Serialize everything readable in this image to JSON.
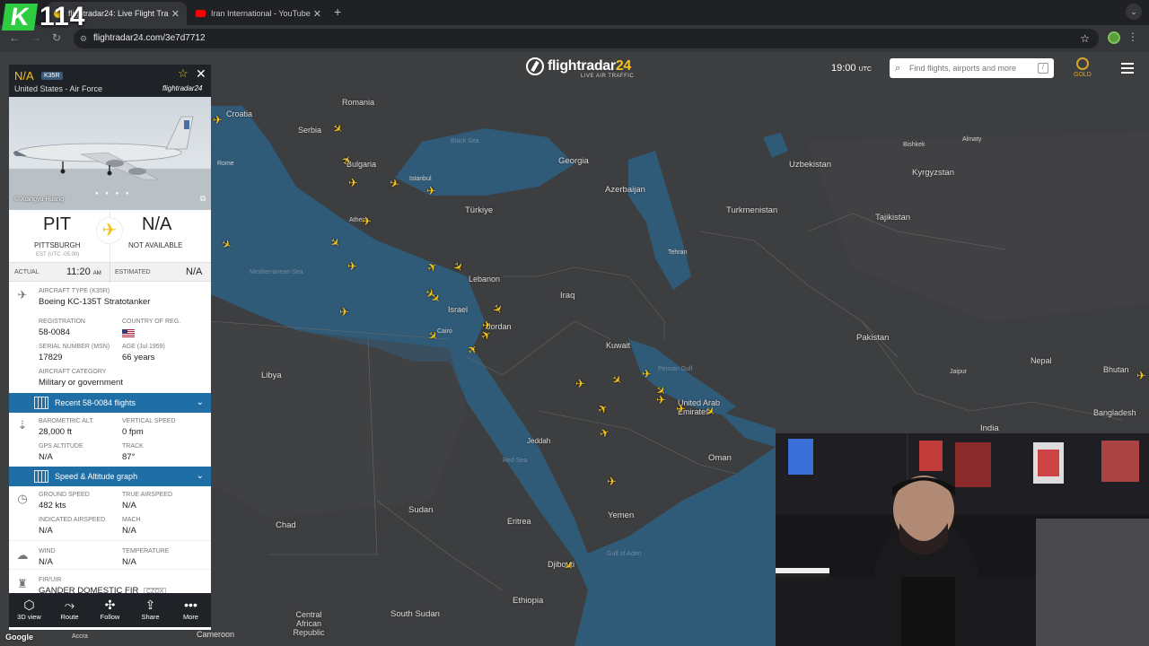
{
  "overlay": {
    "badge_letter": "K",
    "badge_number": "114"
  },
  "browser": {
    "tabs": [
      {
        "title": "flightradar24: Live Flight Tra"
      },
      {
        "title": "Iran International - YouTube"
      }
    ],
    "url": "flightradar24.com/3e7d7712"
  },
  "header": {
    "logo": "flightradar24",
    "logo_accent": "24",
    "tagline": "LIVE AIR TRAFFIC",
    "clock": "19:00",
    "clock_zone": "UTC",
    "search_placeholder": "Find flights, airports and more",
    "search_shortcut": "/",
    "gold_label": "GOLD"
  },
  "flight": {
    "callsign": "N/A",
    "type_code": "K35R",
    "operator": "United States - Air Force",
    "brand": "flightradar24",
    "photo_credit": "© Xiangyu Huang",
    "origin": {
      "code": "PIT",
      "city": "PITTSBURGH",
      "tz": "EST (UTC -05:00)"
    },
    "destination": {
      "code": "N/A",
      "city": "NOT AVAILABLE"
    },
    "times": {
      "actual_label": "ACTUAL",
      "actual": "11:20",
      "actual_suffix": "AM",
      "estimated_label": "ESTIMATED",
      "estimated": "N/A"
    },
    "aircraft": {
      "type_label": "AIRCRAFT TYPE (K35R)",
      "type": "Boeing KC-135T Stratotanker",
      "registration_label": "REGISTRATION",
      "registration": "58-0084",
      "country_label": "COUNTRY OF REG.",
      "serial_label": "SERIAL NUMBER (MSN)",
      "serial": "17829",
      "age_label": "AGE (Jul 1959)",
      "age": "66 years",
      "category_label": "AIRCRAFT CATEGORY",
      "category": "Military or government"
    },
    "recent_flights_bar": "Recent 58-0084 flights",
    "altitude": {
      "baro_label": "BAROMETRIC ALT.",
      "baro": "28,000 ft",
      "vs_label": "VERTICAL SPEED",
      "vs": "0 fpm",
      "gps_label": "GPS ALTITUDE",
      "gps": "N/A",
      "track_label": "TRACK",
      "track": "87°"
    },
    "graph_bar": "Speed & Altitude graph",
    "speed": {
      "gs_label": "GROUND SPEED",
      "gs": "482 kts",
      "tas_label": "TRUE AIRSPEED",
      "tas": "N/A",
      "ias_label": "INDICATED AIRSPEED",
      "ias": "N/A",
      "mach_label": "MACH",
      "mach": "N/A"
    },
    "weather": {
      "wind_label": "WIND",
      "wind": "N/A",
      "temp_label": "TEMPERATURE",
      "temp": "N/A"
    },
    "fir": {
      "label": "FIR/UIR",
      "value": "GANDER DOMESTIC FIR",
      "code": "CZQX"
    },
    "actions": [
      "3D view",
      "Route",
      "Follow",
      "Share",
      "More"
    ]
  },
  "map": {
    "countries": [
      "Croatia",
      "Serbia",
      "Romania",
      "Bulgaria",
      "Türkiye",
      "Georgia",
      "Azerbaijan",
      "Uzbekistan",
      "Kyrgyzstan",
      "Turkmenistan",
      "Tajikistan",
      "Lebanon",
      "Israel",
      "Jordan",
      "Iraq",
      "Kuwait",
      "Libya",
      "Pakistan",
      "Nepal",
      "Bhutan",
      "Bangladesh",
      "India",
      "United Arab Emirates",
      "Oman",
      "Sudan",
      "Eritrea",
      "Yemen",
      "Chad",
      "Djibouti",
      "Ethiopia",
      "South Sudan",
      "Central African Republic",
      "Cameroon"
    ],
    "seas": [
      "Black Sea",
      "Mediterranean Sea",
      "Red Sea",
      "Persian Gulf",
      "Gulf of Aden"
    ],
    "cities": [
      "Rome",
      "Istanbul",
      "Athens",
      "Cairo",
      "Tehran",
      "Jeddah",
      "Almaty",
      "Bishkek",
      "Jaipur",
      "Accra"
    ],
    "attribution": "Google"
  }
}
